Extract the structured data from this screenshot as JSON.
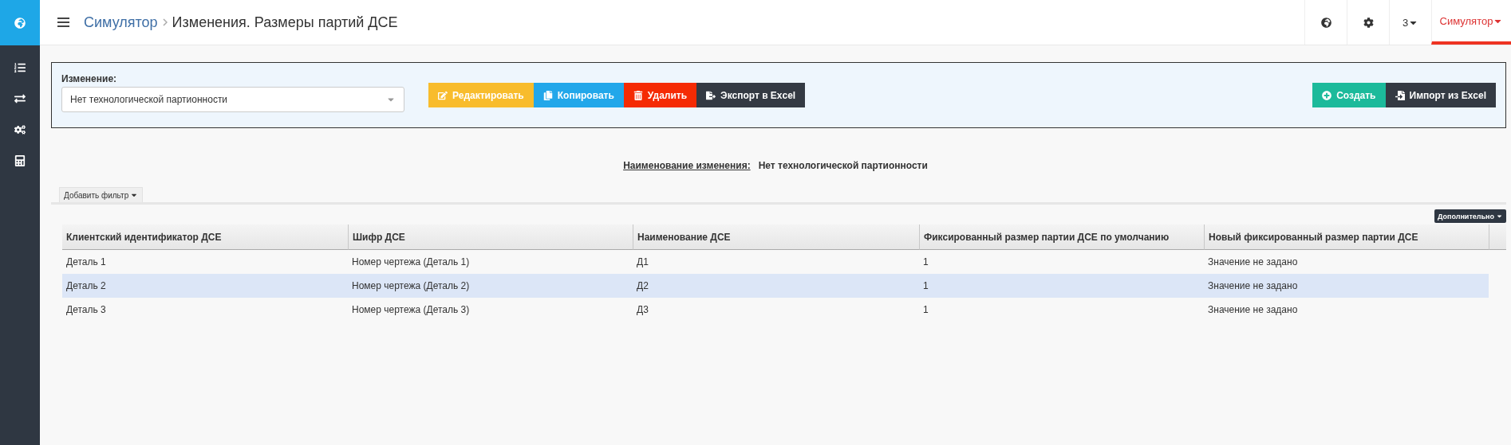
{
  "sidebar": {
    "items": [
      {
        "selected": true
      },
      {
        "selected": false
      },
      {
        "selected": false
      },
      {
        "selected": false
      },
      {
        "selected": false
      }
    ]
  },
  "header": {
    "breadcrumb": [
      "Симулятор",
      "Изменения. Размеры партий ДСЕ"
    ],
    "user_menu": "3",
    "app_menu": "Симулятор"
  },
  "toolbar": {
    "label": "Изменение:",
    "select_value": "Нет технологической партионности",
    "buttons": [
      {
        "kind": "edit",
        "label": "Редактировать"
      },
      {
        "kind": "copy",
        "label": "Копировать"
      },
      {
        "kind": "delete",
        "label": "Удалить"
      },
      {
        "kind": "export",
        "label": "Экспорт в Excel"
      }
    ],
    "right_buttons": [
      {
        "kind": "create",
        "label": "Создать"
      },
      {
        "kind": "import",
        "label": "Импорт из Excel"
      }
    ]
  },
  "change_name": {
    "label": "Наименование изменения:",
    "value": "Нет технологической партионности"
  },
  "filter_button": "Добавить фильтр",
  "more_button": "Дополнительно",
  "table": {
    "columns": [
      "Клиентский идентификатор ДСЕ",
      "Шифр ДСЕ",
      "Наименование ДСЕ",
      "Фиксированный размер партии ДСЕ по умолчанию",
      "Новый фиксированный размер партии ДСЕ"
    ],
    "rows": [
      {
        "cells": [
          "Деталь 1",
          "Номер чертежа (Деталь 1)",
          "Д1",
          "1",
          "Значение не задано"
        ],
        "selected": false
      },
      {
        "cells": [
          "Деталь 2",
          "Номер чертежа (Деталь 2)",
          "Д2",
          "1",
          "Значение не задано"
        ],
        "selected": true
      },
      {
        "cells": [
          "Деталь 3",
          "Номер чертежа (Деталь 3)",
          "Д3",
          "1",
          "Значение не задано"
        ],
        "selected": false
      }
    ]
  }
}
